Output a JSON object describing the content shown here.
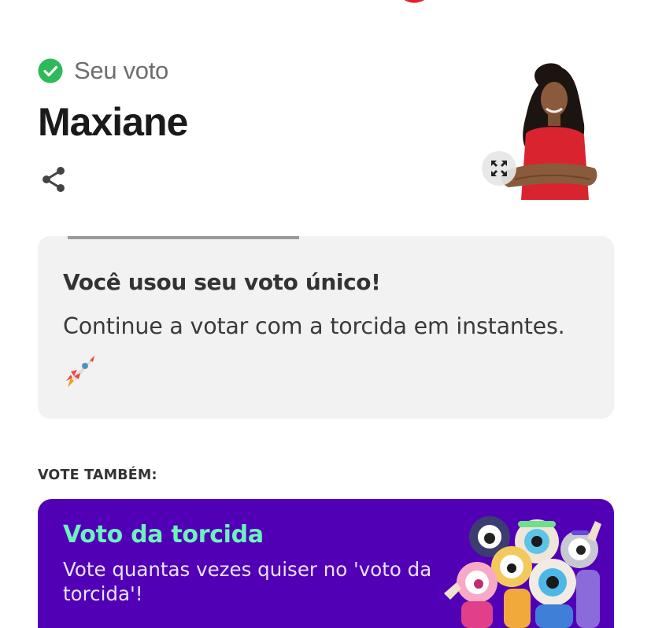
{
  "vote_status": {
    "label": "Seu voto",
    "icon": "check-circle-icon",
    "color": "#2dba5a"
  },
  "candidate": {
    "name": "Maxiane",
    "share_icon": "share-icon",
    "expand_icon": "expand-icon"
  },
  "info_card": {
    "title": "Você usou seu voto único!",
    "text": "Continue a votar com a torcida em instantes.",
    "icon": "rocket-icon",
    "background": "#f2f2f2"
  },
  "vote_also": {
    "heading": "VOTE TAMBÉM:"
  },
  "torcida_card": {
    "title": "Voto da torcida",
    "description": "Vote quantas vezes quiser no 'voto da torcida'!",
    "background": "#5100b6",
    "title_color": "#6ef2bd"
  }
}
